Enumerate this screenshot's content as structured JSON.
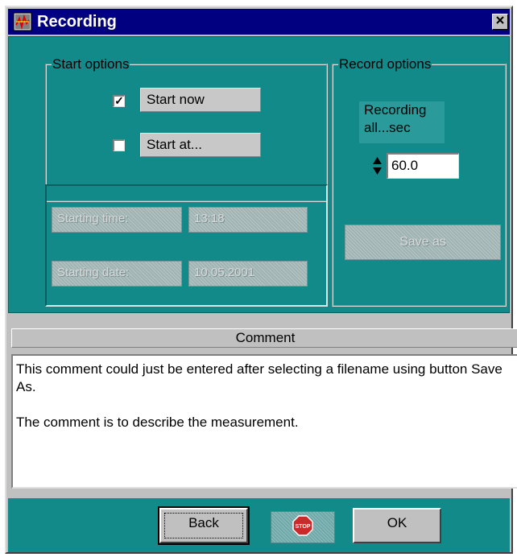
{
  "window": {
    "title": "Recording",
    "icon": "oscilloscope-icon",
    "close_icon": "close-icon"
  },
  "start_options": {
    "legend": "Start options",
    "start_now": {
      "label": "Start now",
      "checked": true
    },
    "start_at": {
      "label": "Start at...",
      "checked": false
    }
  },
  "start_details": {
    "starting_time_label": "Starting time:",
    "starting_time_value": "13:18",
    "starting_date_label": "Starting date:",
    "starting_date_value": "10.05.2001"
  },
  "record_options": {
    "legend": "Record options",
    "recording_label_line1": "Recording",
    "recording_label_line2": "all...sec",
    "interval_value": "60.0",
    "save_as_label": "Save as"
  },
  "comment": {
    "header": "Comment",
    "line1": "This comment could just be entered after selecting a filename using button Save As.",
    "line2": "The comment is to describe the measurement."
  },
  "buttons": {
    "back": "Back",
    "stop_icon": "stop-sign-icon",
    "stop_text": "STOP",
    "ok": "OK"
  },
  "colors": {
    "title_bar": "#000080",
    "panel_teal": "#138a8a",
    "stop_red": "#cc2a2a"
  }
}
